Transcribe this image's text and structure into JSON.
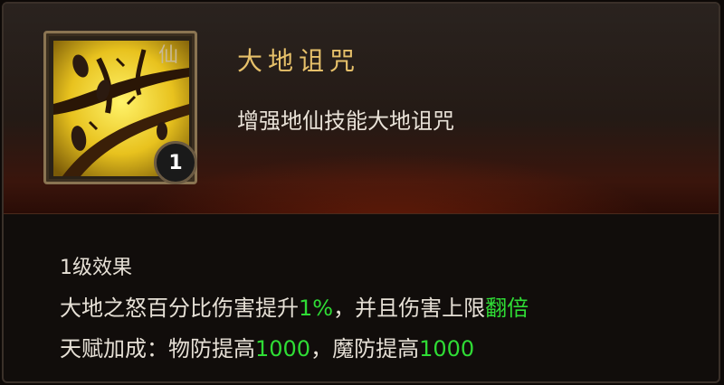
{
  "skill": {
    "name": "大地诅咒",
    "description": "增强地仙技能大地诅咒",
    "icon": "cursed-branch-icon",
    "corner_glyph": "仙",
    "level": "1"
  },
  "effects": {
    "level_heading": "1级效果",
    "line1": {
      "part1": "大地之怒百分比伤害提升",
      "value1": "1%",
      "part2": "，并且伤害上限",
      "value2": "翻倍"
    },
    "line2": {
      "part1": "天赋加成：物防提高",
      "value1": "1000",
      "part2": "，魔防提高",
      "value2": "1000"
    }
  },
  "colors": {
    "title": "#e6c06a",
    "highlight": "#2fdc35",
    "text": "#e6e0d6"
  }
}
